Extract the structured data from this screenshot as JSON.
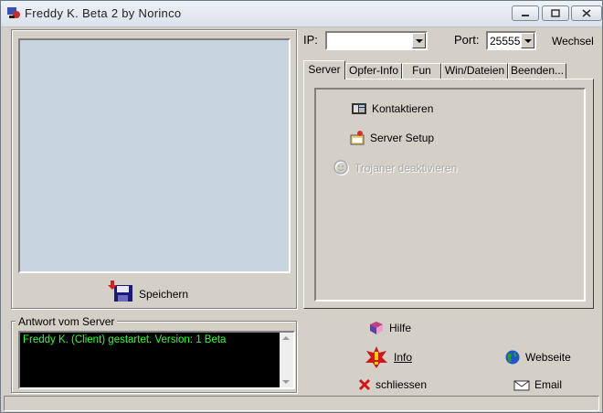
{
  "window": {
    "title": "Freddy K.  Beta  2   by  Norinco",
    "app_icon": "trojan-app-icon",
    "controls": [
      "minimize-icon",
      "maximize-icon",
      "close-icon"
    ]
  },
  "left": {
    "save_label": "Speichern",
    "save_icon": "floppy-save-icon",
    "response_group_label": "Antwort vom Server",
    "response_text": "Freddy K. (Client) gestartet. Version: 1 Beta"
  },
  "connection": {
    "ip_label": "IP:",
    "ip_value": "",
    "port_label": "Port:",
    "port_value": "25555",
    "switch_label": "Wechsel"
  },
  "tabs": [
    {
      "label": "Server",
      "active": true
    },
    {
      "label": "Opfer-Info",
      "active": false
    },
    {
      "label": "Fun",
      "active": false
    },
    {
      "label": "Win/Dateien",
      "active": false
    },
    {
      "label": "Beenden...",
      "active": false
    }
  ],
  "server_tab": {
    "actions": [
      {
        "label": "Kontaktieren",
        "icon": "phone-icon",
        "enabled": true
      },
      {
        "label": "Server Setup",
        "icon": "setup-icon",
        "enabled": true
      },
      {
        "label": "Trojaner deaktivieren",
        "icon": "smiley-icon",
        "enabled": false
      }
    ]
  },
  "bottom_actions": {
    "help": "Hilfe",
    "info": "Info",
    "website": "Webseite",
    "close": "schliessen",
    "email": "Email"
  },
  "colors": {
    "console_bg": "#000000",
    "console_text": "#33ff33",
    "image_area": "#c8d4e0"
  }
}
